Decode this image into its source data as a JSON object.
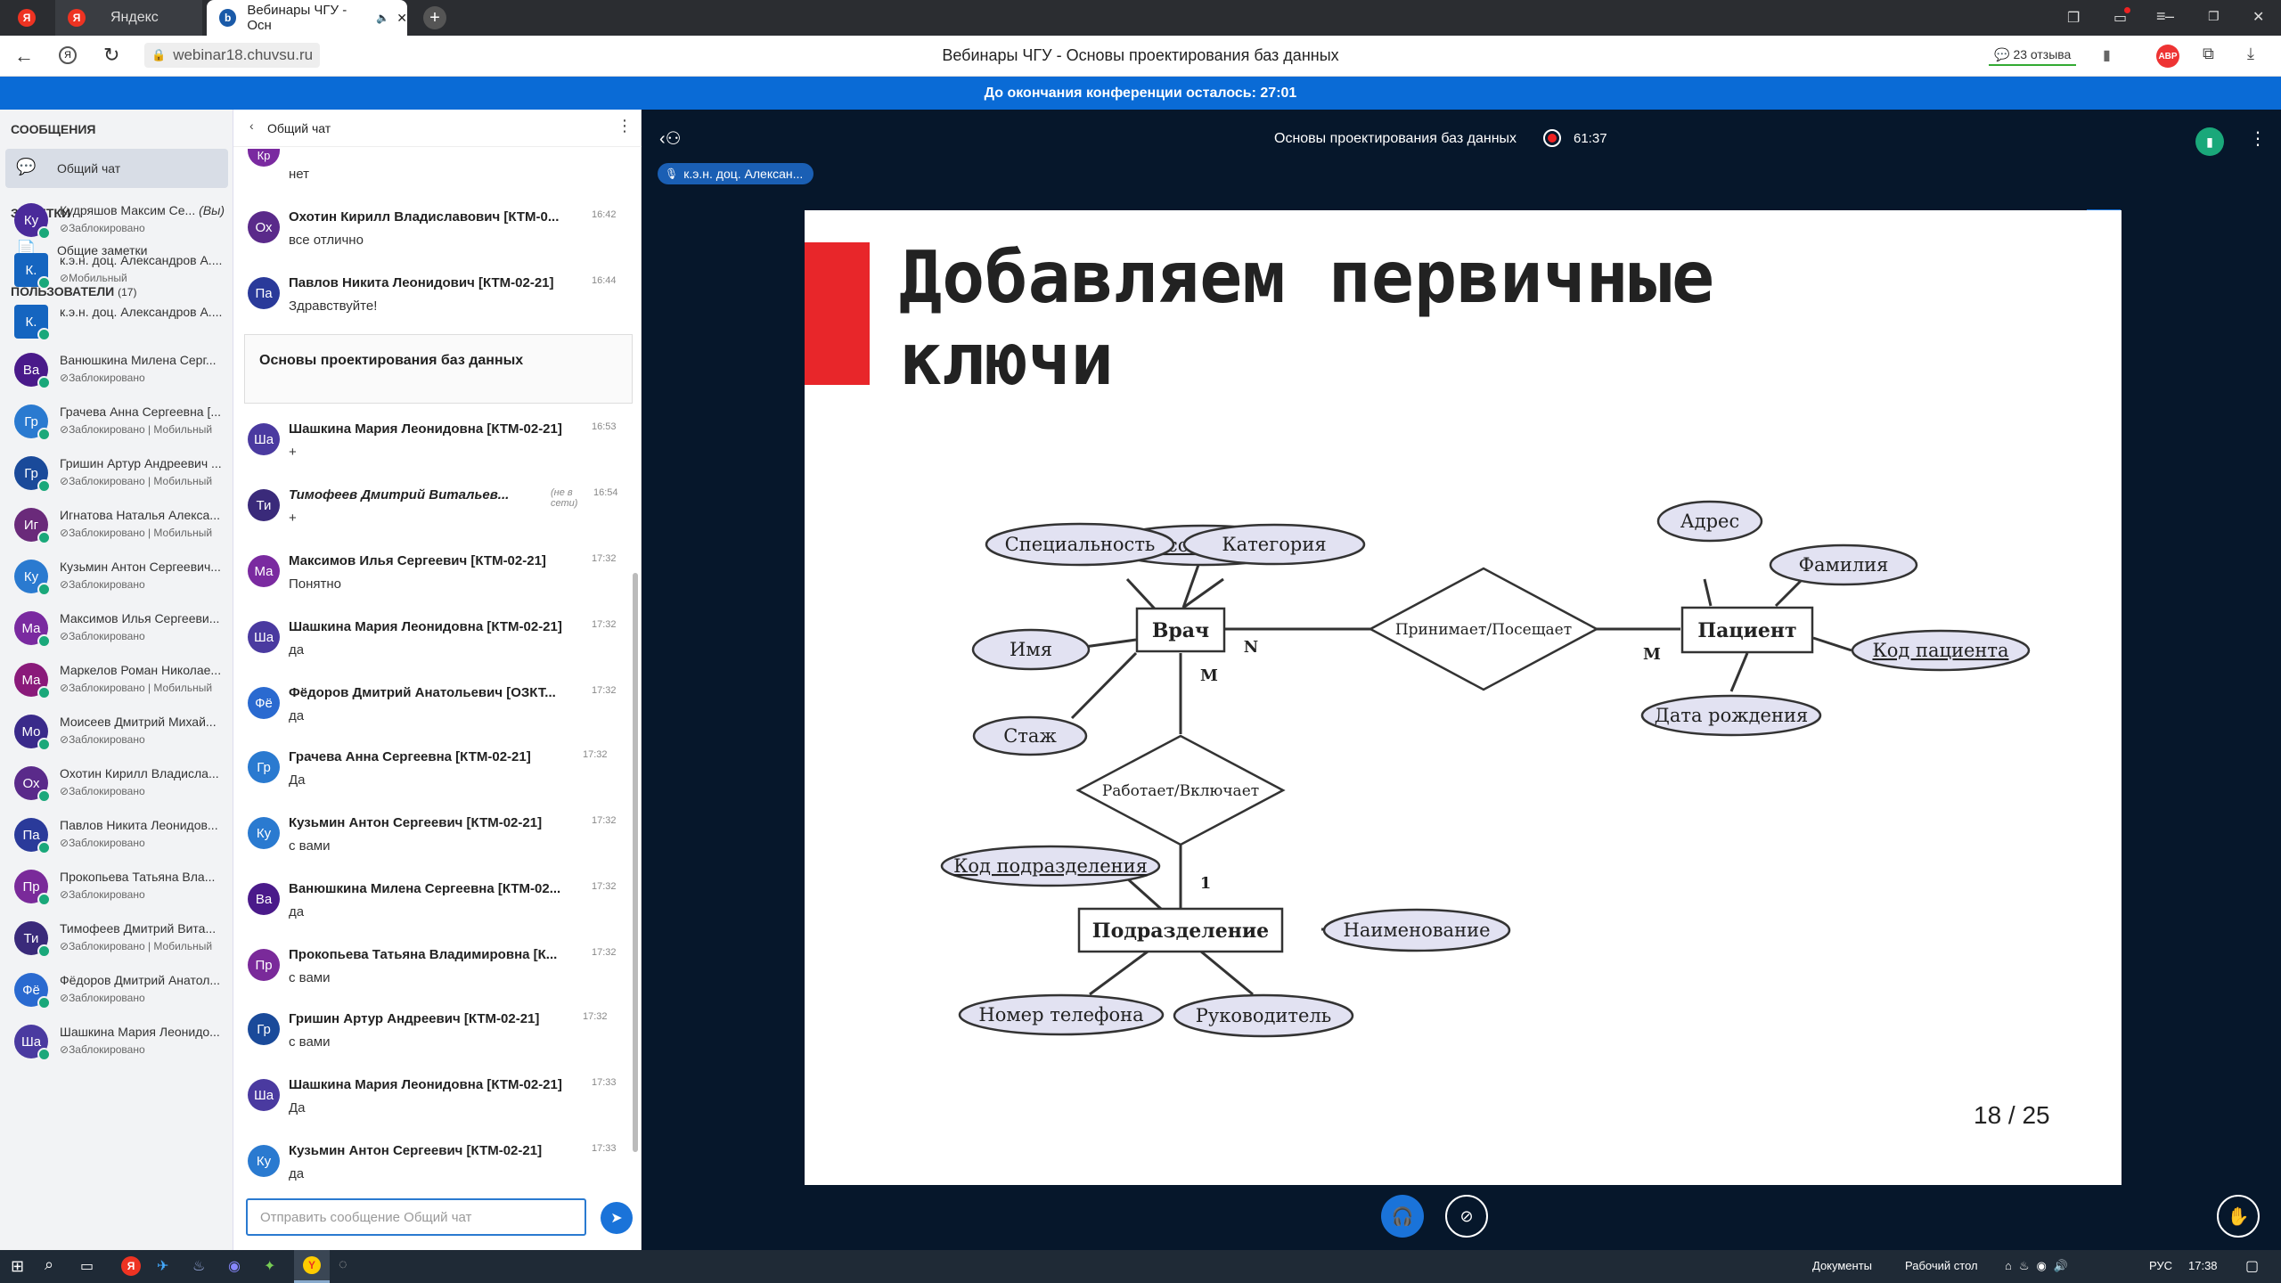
{
  "browser": {
    "tabs": [
      {
        "label": "Яндекс",
        "icon": "yandex-icon"
      },
      {
        "label": "Вебинары ЧГУ - Осн",
        "icon": "webinar-icon"
      }
    ],
    "url": "webinar18.chuvsu.ru",
    "page_title": "Вебинары ЧГУ - Основы проектирования баз данных",
    "reviews": "23 отзыва",
    "abp": "ABP"
  },
  "banner": "До окончания конференции осталось: 27:01",
  "sidebar": {
    "messages_header": "СООБЩЕНИЯ",
    "public_chat": "Общий чат",
    "notes_header": "ЗАМЕТКИ",
    "shared_notes": "Общие заметки",
    "users_header": "ПОЛЬЗОВАТЕЛИ",
    "users_count": "(17)",
    "users": [
      {
        "initials": "Ку",
        "name": "Кудряшов Максим Се...",
        "you": "(Вы)",
        "status": "Заблокировано",
        "color": "#4a2a9a"
      },
      {
        "initials": "К.",
        "name": "к.э.н. доц. Александров А....",
        "status": "Мобильный",
        "color": "#1565c0",
        "square": true
      },
      {
        "initials": "К.",
        "name": "к.э.н. доц. Александров А....",
        "status": "",
        "color": "#1565c0",
        "square": true
      },
      {
        "initials": "Ва",
        "name": "Ванюшкина Милена Серг...",
        "status": "Заблокировано",
        "color": "#4a1a8a"
      },
      {
        "initials": "Гр",
        "name": "Грачева Анна Сергеевна [...",
        "status": "Заблокировано | Мобильный",
        "color": "#2a7ad0"
      },
      {
        "initials": "Гр",
        "name": "Гришин Артур Андреевич ...",
        "status": "Заблокировано | Мобильный",
        "color": "#1a4a9a"
      },
      {
        "initials": "Иг",
        "name": "Игнатова Наталья Алекса...",
        "status": "Заблокировано | Мобильный",
        "color": "#6a2a7a"
      },
      {
        "initials": "Ку",
        "name": "Кузьмин Антон Сергеевич...",
        "status": "Заблокировано",
        "color": "#2a7ad0"
      },
      {
        "initials": "Ма",
        "name": "Максимов Илья Сергееви...",
        "status": "Заблокировано",
        "color": "#7a2aa0"
      },
      {
        "initials": "Ма",
        "name": "Маркелов Роман Николае...",
        "status": "Заблокировано | Мобильный",
        "color": "#8a1a7a"
      },
      {
        "initials": "Мо",
        "name": "Моисеев Дмитрий Михай...",
        "status": "Заблокировано",
        "color": "#3a2a8a"
      },
      {
        "initials": "Ох",
        "name": "Охотин Кирилл Владисла...",
        "status": "Заблокировано",
        "color": "#5a2a8a"
      },
      {
        "initials": "Па",
        "name": "Павлов Никита Леонидов...",
        "status": "Заблокировано",
        "color": "#2a3a9a"
      },
      {
        "initials": "Пр",
        "name": "Прокопьева Татьяна Вла...",
        "status": "Заблокировано",
        "color": "#7a2a9a"
      },
      {
        "initials": "Ти",
        "name": "Тимофеев Дмитрий Вита...",
        "status": "Заблокировано | Мобильный",
        "color": "#3a2a7a"
      },
      {
        "initials": "Фё",
        "name": "Фёдоров Дмитрий Анатол...",
        "status": "Заблокировано",
        "color": "#2a6ad0"
      },
      {
        "initials": "Ша",
        "name": "Шашкина Мария Леонидо...",
        "status": "Заблокировано",
        "color": "#4a3aa0"
      }
    ]
  },
  "chat": {
    "title": "Общий чат",
    "partial": {
      "initials": "Кр",
      "text": "нет",
      "color": "#7a2aa0"
    },
    "messages": [
      {
        "initials": "Ох",
        "name": "Охотин Кирилл Владиславович [КТМ-0...",
        "time": "16:42",
        "text": "все отлично",
        "color": "#5a2a8a"
      },
      {
        "initials": "Па",
        "name": "Павлов Никита Леонидович [КТМ-02-21]",
        "time": "16:44",
        "text": "Здравствуйте!",
        "color": "#2a3a9a"
      }
    ],
    "welcome": "Основы проектирования баз данных",
    "messages2": [
      {
        "initials": "Ша",
        "name": "Шашкина Мария Леонидовна [КТМ-02-21]",
        "time": "16:53",
        "text": "+",
        "color": "#4a3aa0"
      },
      {
        "initials": "Ти",
        "name": "Тимофеев Дмитрий Витальев...",
        "time": "16:54",
        "offline": "(не в сети)",
        "text": "+",
        "color": "#3a2a7a",
        "italic": true
      },
      {
        "initials": "Ма",
        "name": "Максимов Илья Сергеевич [КТМ-02-21]",
        "time": "17:32",
        "text": "Понятно",
        "color": "#7a2aa0"
      },
      {
        "initials": "Ша",
        "name": "Шашкина Мария Леонидовна [КТМ-02-21]",
        "time": "17:32",
        "text": "да",
        "color": "#4a3aa0"
      },
      {
        "initials": "Фё",
        "name": "Фёдоров Дмитрий Анатольевич [ОЗКТ...",
        "time": "17:32",
        "text": "да",
        "color": "#2a6ad0"
      },
      {
        "initials": "Гр",
        "name": "Грачева Анна Сергеевна [КТМ-02-21]",
        "time": "17:32",
        "text": "Да",
        "color": "#2a7ad0"
      },
      {
        "initials": "Ку",
        "name": "Кузьмин Антон Сергеевич [КТМ-02-21]",
        "time": "17:32",
        "text": "с вами",
        "color": "#2a7ad0"
      },
      {
        "initials": "Ва",
        "name": "Ванюшкина Милена Сергеевна [КТМ-02...",
        "time": "17:32",
        "text": "да",
        "color": "#4a1a8a"
      },
      {
        "initials": "Пр",
        "name": "Прокопьева Татьяна Владимировна [К...",
        "time": "17:32",
        "text": "с вами",
        "color": "#7a2a9a"
      },
      {
        "initials": "Гр",
        "name": "Гришин Артур Андреевич [КТМ-02-21]",
        "time": "17:32",
        "text": "с вами",
        "color": "#1a4a9a"
      },
      {
        "initials": "Ша",
        "name": "Шашкина Мария Леонидовна [КТМ-02-21]",
        "time": "17:33",
        "text": "Да",
        "color": "#4a3aa0"
      },
      {
        "initials": "Ку",
        "name": "Кузьмин Антон Сергеевич [КТМ-02-21]",
        "time": "17:33",
        "text": "да",
        "color": "#2a7ad0"
      }
    ],
    "input_placeholder": "Отправить сообщение Общий чат"
  },
  "presentation": {
    "title": "Основы проектирования баз данных",
    "rec_time": "61:37",
    "presenter": "к.э.н. доц. Алексан...",
    "slide_title_1": "Добавляем первичные",
    "slide_title_2": "ключи",
    "page": "18 / 25",
    "diagram": {
      "entities": [
        "Врач",
        "Пациент",
        "Подразделение"
      ],
      "relations": [
        "Принимает/Посещает",
        "Работает/Включает"
      ],
      "attributes": [
        "Код сотрудника",
        "Специальность",
        "Категория",
        "Имя",
        "Стаж",
        "Адрес",
        "Фамилия",
        "Код пациента",
        "Дата рождения",
        "Код подразделения",
        "Наименование",
        "Номер телефона",
        "Руководитель"
      ],
      "cardinality": [
        "N",
        "M",
        "M",
        "1"
      ]
    }
  },
  "taskbar": {
    "documents": "Документы",
    "desktop": "Рабочий стол",
    "lang": "РУС",
    "time": "17:38"
  }
}
